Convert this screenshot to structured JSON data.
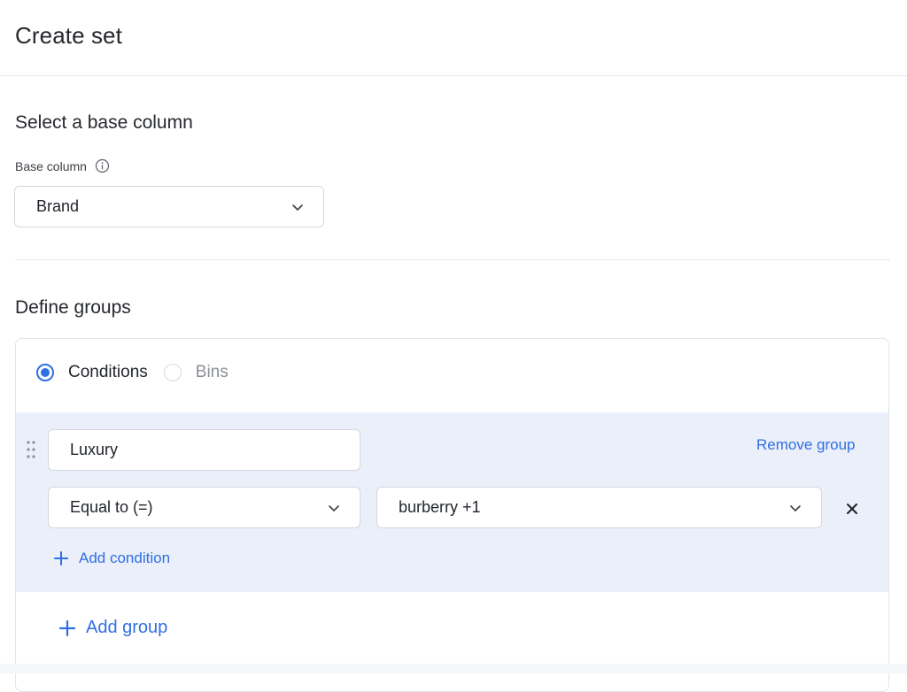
{
  "header": {
    "title": "Create set"
  },
  "base_section": {
    "heading": "Select a base column",
    "label": "Base column",
    "selected": "Brand"
  },
  "groups_section": {
    "heading": "Define groups",
    "modes": [
      {
        "label": "Conditions",
        "checked": true
      },
      {
        "label": "Bins",
        "checked": false
      }
    ],
    "group": {
      "name": "Luxury",
      "remove_label": "Remove group",
      "operator": "Equal to (=)",
      "value": "burberry +1",
      "add_condition_label": "Add condition"
    },
    "add_group_label": "Add group"
  },
  "colors": {
    "accent": "#2f6fe4",
    "group_background": "#eaeff9",
    "border": "#d4d7dc"
  },
  "icons": [
    "info-icon",
    "chevron-down-icon",
    "drag-handle-icon",
    "close-icon",
    "plus-icon"
  ]
}
